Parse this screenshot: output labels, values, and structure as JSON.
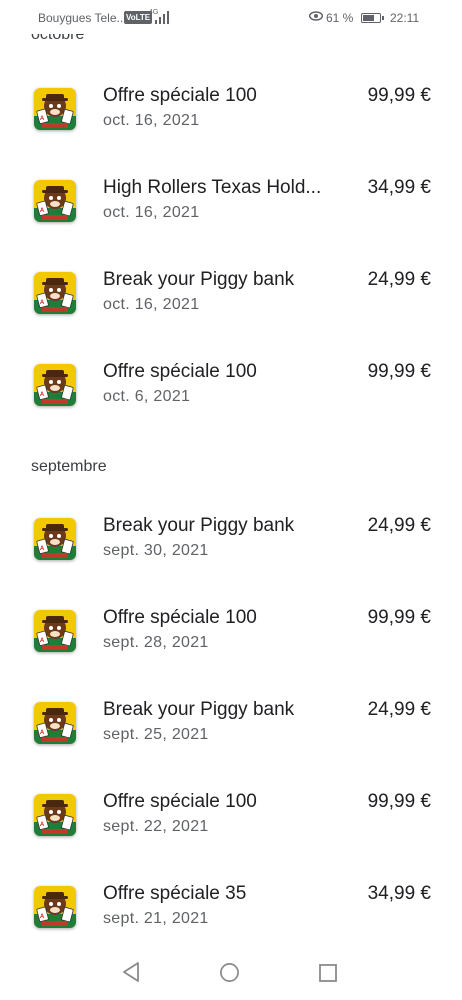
{
  "status_bar": {
    "carrier": "Bouygues Tele...",
    "volte": "VoLTE",
    "network": "4G",
    "battery_percent": "61 %",
    "time": "22:11"
  },
  "sections": {
    "october": "octobre",
    "september": "septembre"
  },
  "purchases": [
    {
      "title": "Offre spéciale 100",
      "date": "oct. 16, 2021",
      "price": "99,99 €"
    },
    {
      "title": "High Rollers Texas Hold...",
      "date": "oct. 16, 2021",
      "price": "34,99 €"
    },
    {
      "title": "Break your Piggy bank",
      "date": "oct. 16, 2021",
      "price": "24,99 €"
    },
    {
      "title": "Offre spéciale 100",
      "date": "oct. 6, 2021",
      "price": "99,99 €"
    },
    {
      "title": "Break your Piggy bank",
      "date": "sept. 30, 2021",
      "price": "24,99 €"
    },
    {
      "title": "Offre spéciale 100",
      "date": "sept. 28, 2021",
      "price": "99,99 €"
    },
    {
      "title": "Break your Piggy bank",
      "date": "sept. 25, 2021",
      "price": "24,99 €"
    },
    {
      "title": "Offre spéciale 100",
      "date": "sept. 22, 2021",
      "price": "99,99 €"
    },
    {
      "title": "Offre spéciale 35",
      "date": "sept. 21, 2021",
      "price": "34,99 €"
    }
  ],
  "icons": {
    "app": "poker-game-app-icon",
    "nav_back": "back-triangle-icon",
    "nav_home": "home-circle-icon",
    "nav_recent": "recent-apps-square-icon"
  },
  "colors": {
    "icon_background": "#f2c800",
    "text_primary": "#202124",
    "text_secondary": "#5f6368"
  }
}
